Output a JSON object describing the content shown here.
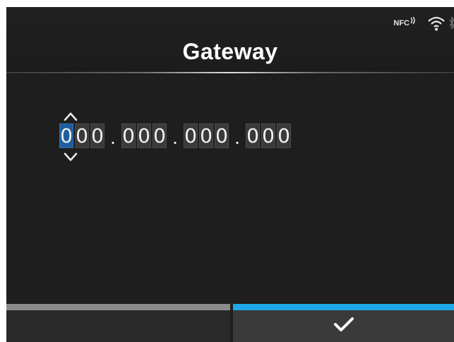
{
  "header": {
    "title": "Gateway",
    "status_icons": {
      "nfc_label": "NFC",
      "wifi": "wifi-icon",
      "bluetooth": "bluetooth-icon"
    }
  },
  "ip_editor": {
    "octets": [
      [
        "0",
        "0",
        "0"
      ],
      [
        "0",
        "0",
        "0"
      ],
      [
        "0",
        "0",
        "0"
      ],
      [
        "0",
        "0",
        "0"
      ]
    ],
    "separator": ".",
    "selected_digit": "0"
  },
  "footer": {
    "left_button": "",
    "right_button_icon": "check-icon"
  },
  "colors": {
    "selected": "#1f5f9f",
    "accent": "#1ea8e6",
    "background": "#1f1f1f"
  }
}
